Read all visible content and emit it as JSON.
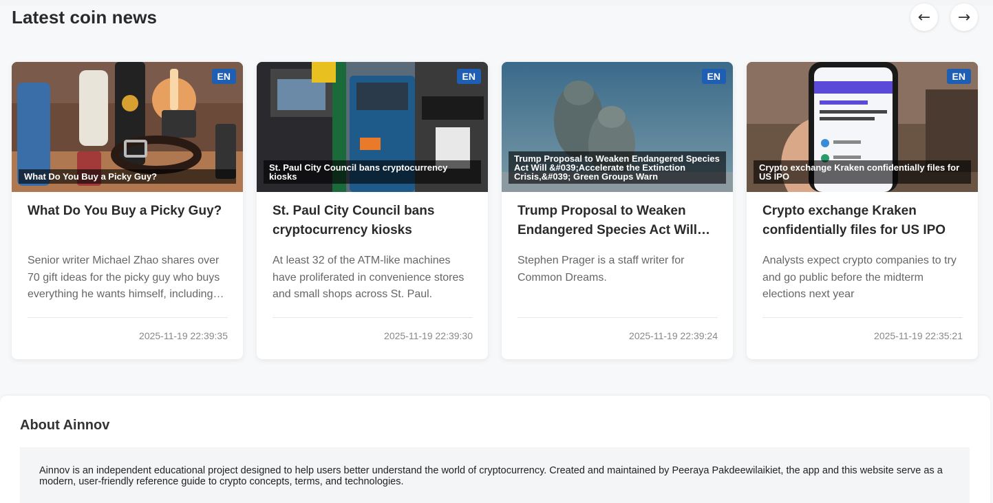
{
  "section": {
    "title": "Latest coin news",
    "prev_label": "←",
    "next_label": "→"
  },
  "cards": [
    {
      "lang": "EN",
      "caption": "What Do You Buy a Picky Guy?",
      "title": "What Do You Buy a Picky Guy?",
      "summary": "Senior writer Michael Zhao shares over 70 gift ideas for the picky guy who buys everything he wants himself, including…",
      "date": "2025-11-19 22:39:35"
    },
    {
      "lang": "EN",
      "caption": "St. Paul City Council bans cryptocurrency kiosks",
      "title": "St. Paul City Council bans cryptocurrency kiosks",
      "summary": "At least 32 of the ATM-like machines have proliferated in convenience stores and small shops across St. Paul.",
      "date": "2025-11-19 22:39:30"
    },
    {
      "lang": "EN",
      "caption": "Trump Proposal to Weaken Endangered Species Act Will &#039;Accelerate the Extinction Crisis,&#039; Green Groups Warn",
      "title": "Trump Proposal to Weaken Endangered Species Act Will…",
      "summary": "Stephen Prager is a staff writer for Common Dreams.",
      "date": "2025-11-19 22:39:24"
    },
    {
      "lang": "EN",
      "caption": "Crypto exchange Kraken confidentially files for US IPO",
      "title": "Crypto exchange Kraken confidentially files for US IPO",
      "summary": "Analysts expect crypto companies to try and go public before the midterm elections next year",
      "date": "2025-11-19 22:35:21"
    }
  ],
  "about": {
    "title": "About Ainnov",
    "text": "Ainnov is an independent educational project designed to help users better understand the world of cryptocurrency. Created and maintained by Peeraya Pakdeewilaikiet, the app and this website serve as a modern, user-friendly reference guide to crypto concepts, terms, and technologies."
  },
  "colors": {
    "badge": "#1e5fb4",
    "page_bg": "#f7f8fa"
  }
}
